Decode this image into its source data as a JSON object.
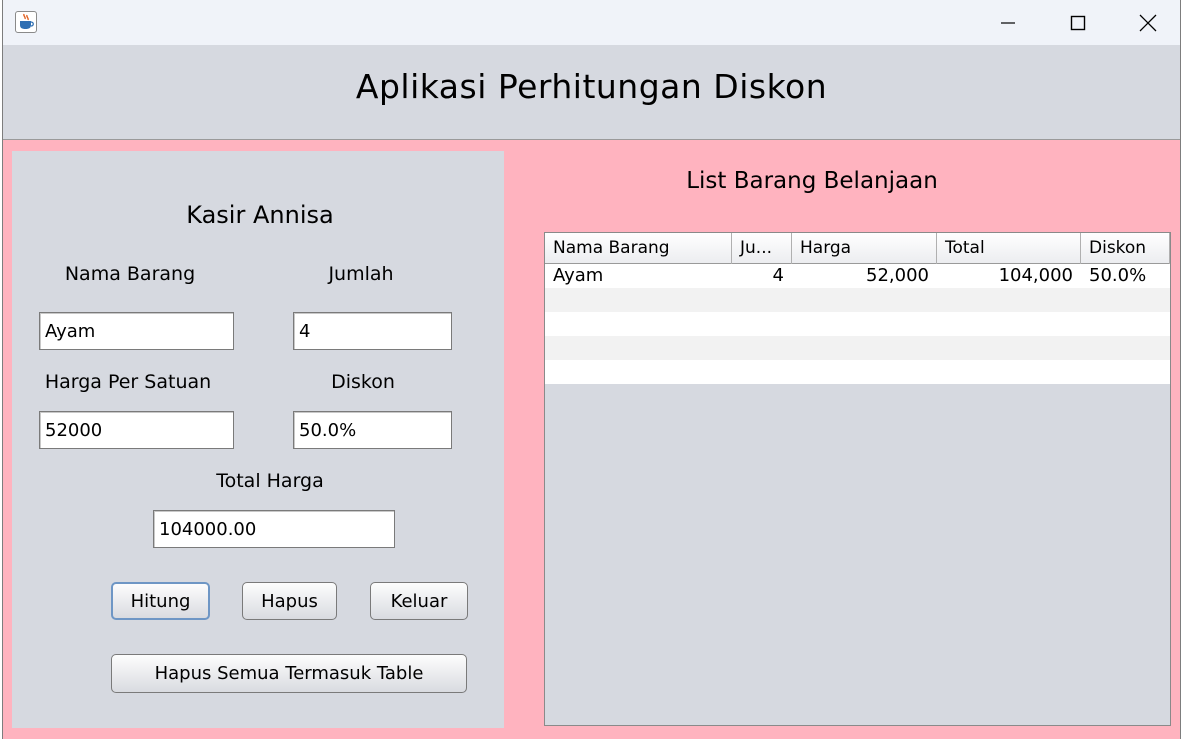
{
  "window": {
    "icon": "java-coffee-cup-icon"
  },
  "header": {
    "title": "Aplikasi Perhitungan Diskon"
  },
  "form": {
    "title": "Kasir Annisa",
    "nama_barang_label": "Nama Barang",
    "nama_barang_value": "Ayam",
    "jumlah_label": "Jumlah",
    "jumlah_value": "4",
    "harga_label": "Harga Per Satuan",
    "harga_value": "52000",
    "diskon_label": "Diskon",
    "diskon_value": "50.0%",
    "total_label": "Total Harga",
    "total_value": "104000.00",
    "hitung_label": "Hitung",
    "hapus_label": "Hapus",
    "keluar_label": "Keluar",
    "hapus_semua_label": "Hapus Semua Termasuk Table"
  },
  "list": {
    "title": "List Barang Belanjaan",
    "columns": [
      "Nama Barang",
      "Ju...",
      "Harga",
      "Total",
      "Diskon"
    ],
    "rows": [
      [
        "Ayam",
        "4",
        "52,000",
        "104,000",
        "50.0%"
      ]
    ]
  },
  "colors": {
    "window_bg": "#ffb3bf",
    "panel_bg": "#d6d9e0",
    "titlebar_bg": "#f0f3f9",
    "focus_border": "#6e96c5",
    "stripe_row": "#f2f2f2"
  }
}
